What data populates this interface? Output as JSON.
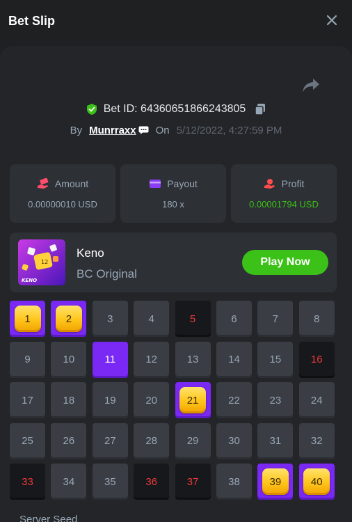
{
  "header": {
    "title": "Bet Slip"
  },
  "bet": {
    "id_label": "Bet ID: 64360651866243805",
    "by_label": "By",
    "user": "Munrraxx",
    "on_label": "On",
    "date": "5/12/2022, 4:27:59 PM"
  },
  "stats": [
    {
      "label": "Amount",
      "value": "0.00000010 USD",
      "icon": "money-hand-icon",
      "color": "#ff4d6d"
    },
    {
      "label": "Payout",
      "value": "180 x",
      "icon": "card-icon",
      "color": "#8a3cf6"
    },
    {
      "label": "Profit",
      "value": "0.00001794 USD",
      "icon": "coin-hand-icon",
      "color": "#ff4d4d"
    }
  ],
  "game": {
    "name": "Keno",
    "subtitle": "BC Original",
    "play_label": "Play Now",
    "thumb_text": "KENO",
    "thumb_ball": "12"
  },
  "grid": [
    {
      "n": "1",
      "state": "hit"
    },
    {
      "n": "2",
      "state": "hit"
    },
    {
      "n": "3",
      "state": "none"
    },
    {
      "n": "4",
      "state": "none"
    },
    {
      "n": "5",
      "state": "miss"
    },
    {
      "n": "6",
      "state": "none"
    },
    {
      "n": "7",
      "state": "none"
    },
    {
      "n": "8",
      "state": "none"
    },
    {
      "n": "9",
      "state": "none"
    },
    {
      "n": "10",
      "state": "none"
    },
    {
      "n": "11",
      "state": "picked"
    },
    {
      "n": "12",
      "state": "none"
    },
    {
      "n": "13",
      "state": "none"
    },
    {
      "n": "14",
      "state": "none"
    },
    {
      "n": "15",
      "state": "none"
    },
    {
      "n": "16",
      "state": "miss"
    },
    {
      "n": "17",
      "state": "none"
    },
    {
      "n": "18",
      "state": "none"
    },
    {
      "n": "19",
      "state": "none"
    },
    {
      "n": "20",
      "state": "none"
    },
    {
      "n": "21",
      "state": "hit"
    },
    {
      "n": "22",
      "state": "none"
    },
    {
      "n": "23",
      "state": "none"
    },
    {
      "n": "24",
      "state": "none"
    },
    {
      "n": "25",
      "state": "none"
    },
    {
      "n": "26",
      "state": "none"
    },
    {
      "n": "27",
      "state": "none"
    },
    {
      "n": "28",
      "state": "none"
    },
    {
      "n": "29",
      "state": "none"
    },
    {
      "n": "30",
      "state": "none"
    },
    {
      "n": "31",
      "state": "none"
    },
    {
      "n": "32",
      "state": "none"
    },
    {
      "n": "33",
      "state": "miss"
    },
    {
      "n": "34",
      "state": "none"
    },
    {
      "n": "35",
      "state": "none"
    },
    {
      "n": "36",
      "state": "miss"
    },
    {
      "n": "37",
      "state": "miss"
    },
    {
      "n": "38",
      "state": "none"
    },
    {
      "n": "39",
      "state": "hit"
    },
    {
      "n": "40",
      "state": "hit"
    }
  ],
  "footer": {
    "seed_label": "Server Seed"
  },
  "colors": {
    "accent_purple": "#7a28f3",
    "green": "#3bc117",
    "red": "#ed3a3a",
    "gold": "#ffc41a"
  }
}
